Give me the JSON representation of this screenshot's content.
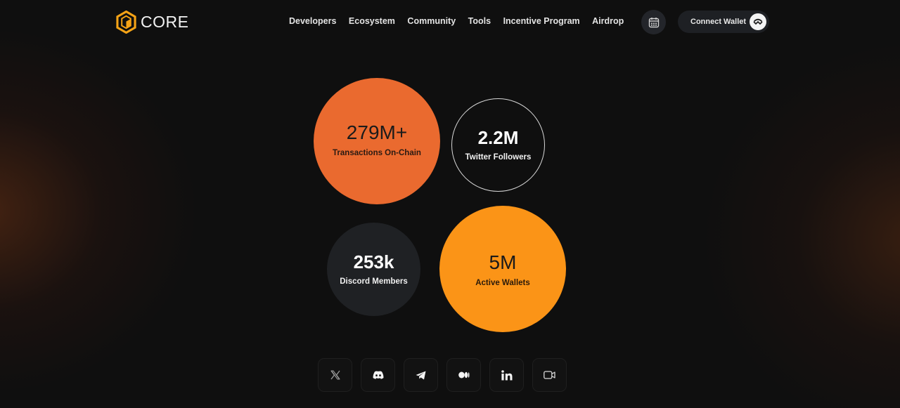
{
  "brand": {
    "name": "CORE",
    "logo_icon": "core-hexagon-cube-icon",
    "accent_color": "#f5a316"
  },
  "nav": {
    "items": [
      {
        "label": "Developers"
      },
      {
        "label": "Ecosystem"
      },
      {
        "label": "Community"
      },
      {
        "label": "Tools"
      },
      {
        "label": "Incentive Program"
      },
      {
        "label": "Airdrop"
      }
    ]
  },
  "header_actions": {
    "calendar_icon": "calendar-icon",
    "connect_wallet_label": "Connect Wallet",
    "wallet_icon": "walletconnect-icon"
  },
  "stats": [
    {
      "id": "transactions",
      "value": "279M+",
      "label": "Transactions On-Chain",
      "color": "#ea6a2f"
    },
    {
      "id": "twitter",
      "value": "2.2M",
      "label": "Twitter Followers",
      "color": "outline"
    },
    {
      "id": "discord",
      "value": "253k",
      "label": "Discord Members",
      "color": "#1f2124"
    },
    {
      "id": "wallets",
      "value": "5M",
      "label": "Active Wallets",
      "color": "#fb9417"
    }
  ],
  "socials": [
    {
      "name": "x",
      "icon": "x-icon"
    },
    {
      "name": "discord",
      "icon": "discord-icon"
    },
    {
      "name": "telegram",
      "icon": "telegram-icon"
    },
    {
      "name": "medium",
      "icon": "medium-icon"
    },
    {
      "name": "linkedin",
      "icon": "linkedin-icon"
    },
    {
      "name": "video",
      "icon": "video-camera-icon"
    }
  ]
}
